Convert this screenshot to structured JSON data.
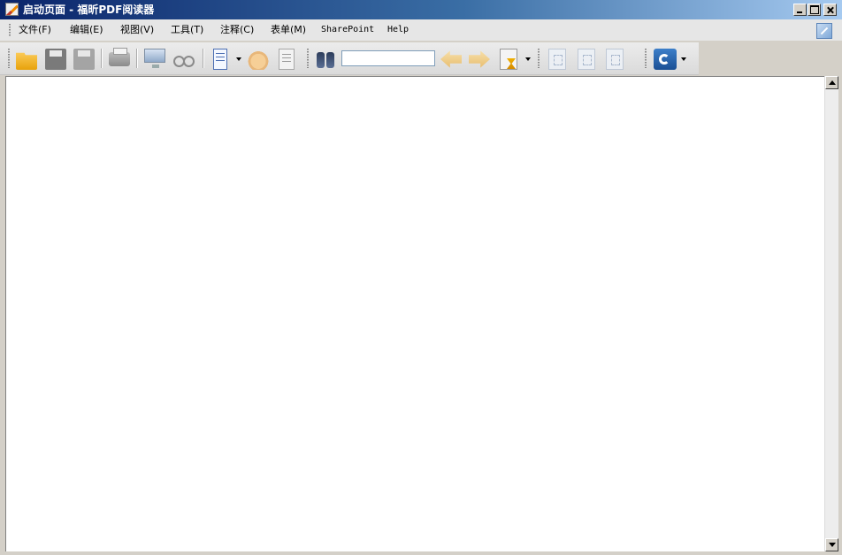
{
  "window": {
    "title": "启动页面 - 福昕PDF阅读器"
  },
  "menubar": {
    "items": [
      {
        "label": "文件(F)"
      },
      {
        "label": "编辑(E)"
      },
      {
        "label": "视图(V)"
      },
      {
        "label": "工具(T)"
      },
      {
        "label": "注释(C)"
      },
      {
        "label": "表单(M)"
      },
      {
        "label": "SharePoint"
      },
      {
        "label": "Help"
      }
    ]
  },
  "toolbar": {
    "search": {
      "value": "",
      "placeholder": ""
    },
    "icons": [
      "folder-open-icon",
      "save-icon",
      "save-as-icon",
      "print-icon",
      "monitor-icon",
      "glasses-icon",
      "page-icon",
      "hand-icon",
      "select-text-icon",
      "find-icon",
      "previous-icon",
      "next-icon",
      "hourglass-icon",
      "zoom-100-icon",
      "rotate-icon",
      "fit-page-icon",
      "link-icon"
    ]
  },
  "document": {
    "content": ""
  }
}
